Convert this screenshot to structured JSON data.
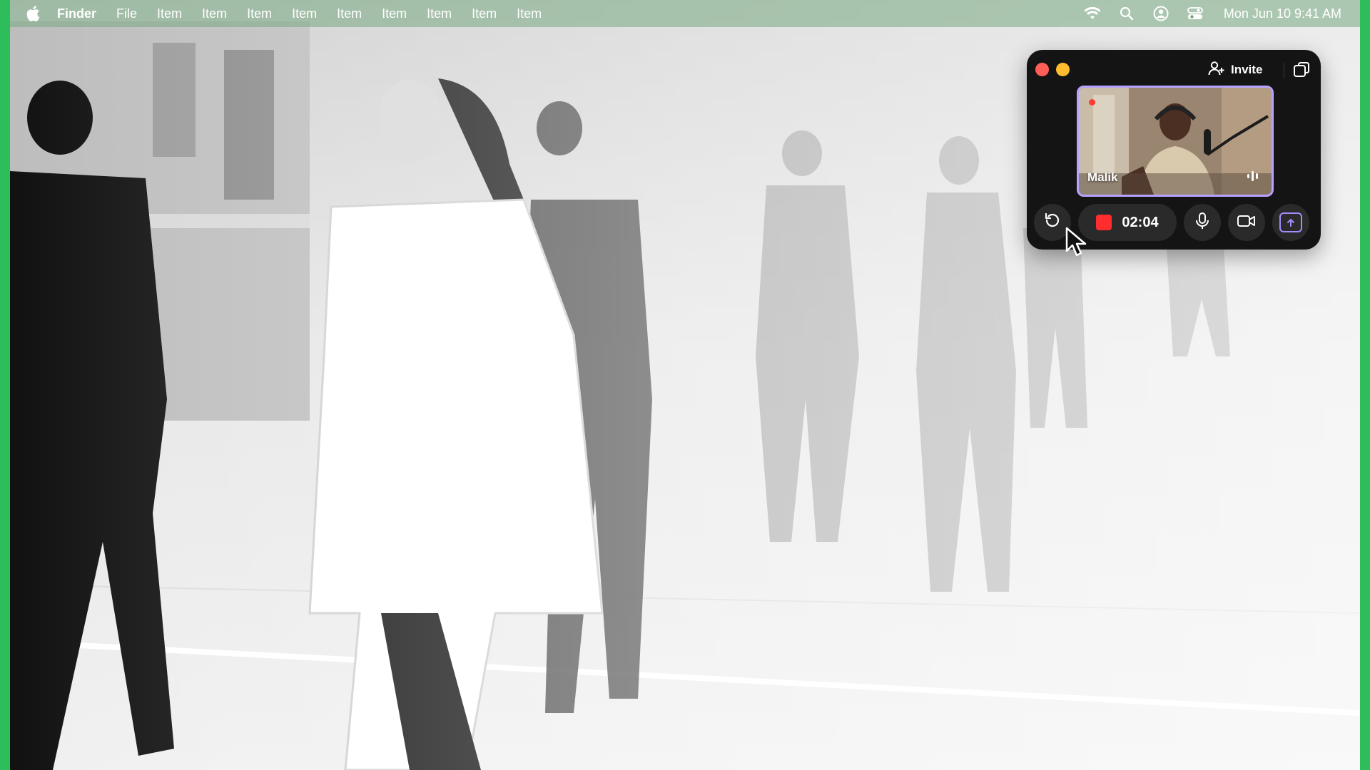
{
  "menubar": {
    "app_name": "Finder",
    "items": [
      "File",
      "Item",
      "Item",
      "Item",
      "Item",
      "Item",
      "Item",
      "Item",
      "Item",
      "Item"
    ],
    "status_icons": [
      "wifi-icon",
      "search-icon",
      "user-icon",
      "control-center-icon"
    ],
    "clock": "Mon Jun 10  9:41 AM"
  },
  "call": {
    "invite_label": "Invite",
    "participant_name": "Malik",
    "timer": "02:04",
    "recording": true,
    "colors": {
      "accent": "#b8a2ff",
      "record": "#ff2d2d",
      "close": "#ff5f57",
      "minimize": "#febc2e"
    }
  }
}
